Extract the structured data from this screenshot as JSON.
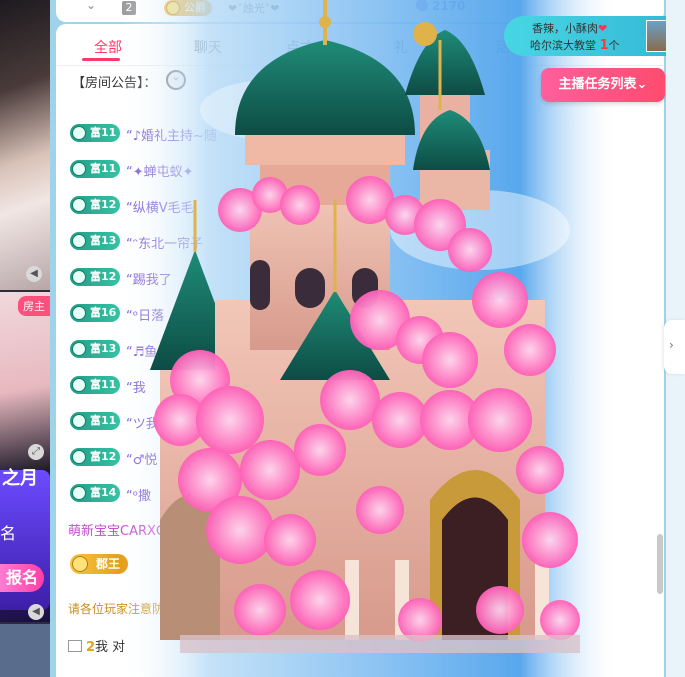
{
  "top_strip": {
    "index": "2",
    "badge": "公爵",
    "name": "❤ˇ烛光ˇ❤",
    "points": "2170"
  },
  "tabs": [
    {
      "label": "全部",
      "active": true
    },
    {
      "label": "聊天"
    },
    {
      "label": "点才"
    },
    {
      "label": "礼"
    },
    {
      "label": "活"
    }
  ],
  "notice": "【房间公告】：",
  "chat": [
    {
      "level": "富11",
      "name": "“♪婚礼主持~随"
    },
    {
      "level": "富11",
      "name": "“✦蝉屯蚁✦"
    },
    {
      "level": "富12",
      "name": "“纵横V毛毛"
    },
    {
      "level": "富13",
      "name": "“ᵔ东北一帘子"
    },
    {
      "level": "富12",
      "name": "“踢我了"
    },
    {
      "level": "富16",
      "name": "“ᵒ日落"
    },
    {
      "level": "富13",
      "name": "“♬鱼"
    },
    {
      "level": "富11",
      "name": "“我"
    },
    {
      "level": "富11",
      "name": "“ツ我"
    },
    {
      "level": "富12",
      "name": "“♂悦"
    },
    {
      "level": "富14",
      "name": "“ᵒ撒"
    }
  ],
  "guest_line": "萌新宝宝CARXG4",
  "rank_badge": "郡王",
  "warn_line": "请各位玩家注意防",
  "bottom_line": {
    "num": "2",
    "text": "我 对 "
  },
  "left": {
    "host_badge": "房主",
    "reg_title": "之月",
    "reg_label": "名",
    "reg_button": "报名"
  },
  "ad": {
    "line1": "香辣，小酥肉",
    "line2_prefix": "哈尔滨大教堂",
    "line2_count": "1",
    "line2_suffix": "个"
  },
  "task_button": "主播任务列表⌄",
  "colors": {
    "accent": "#ff3a6a",
    "level_green": "#1f9e86",
    "name_purple": "#7b5bd1",
    "gold": "#e29a14"
  }
}
